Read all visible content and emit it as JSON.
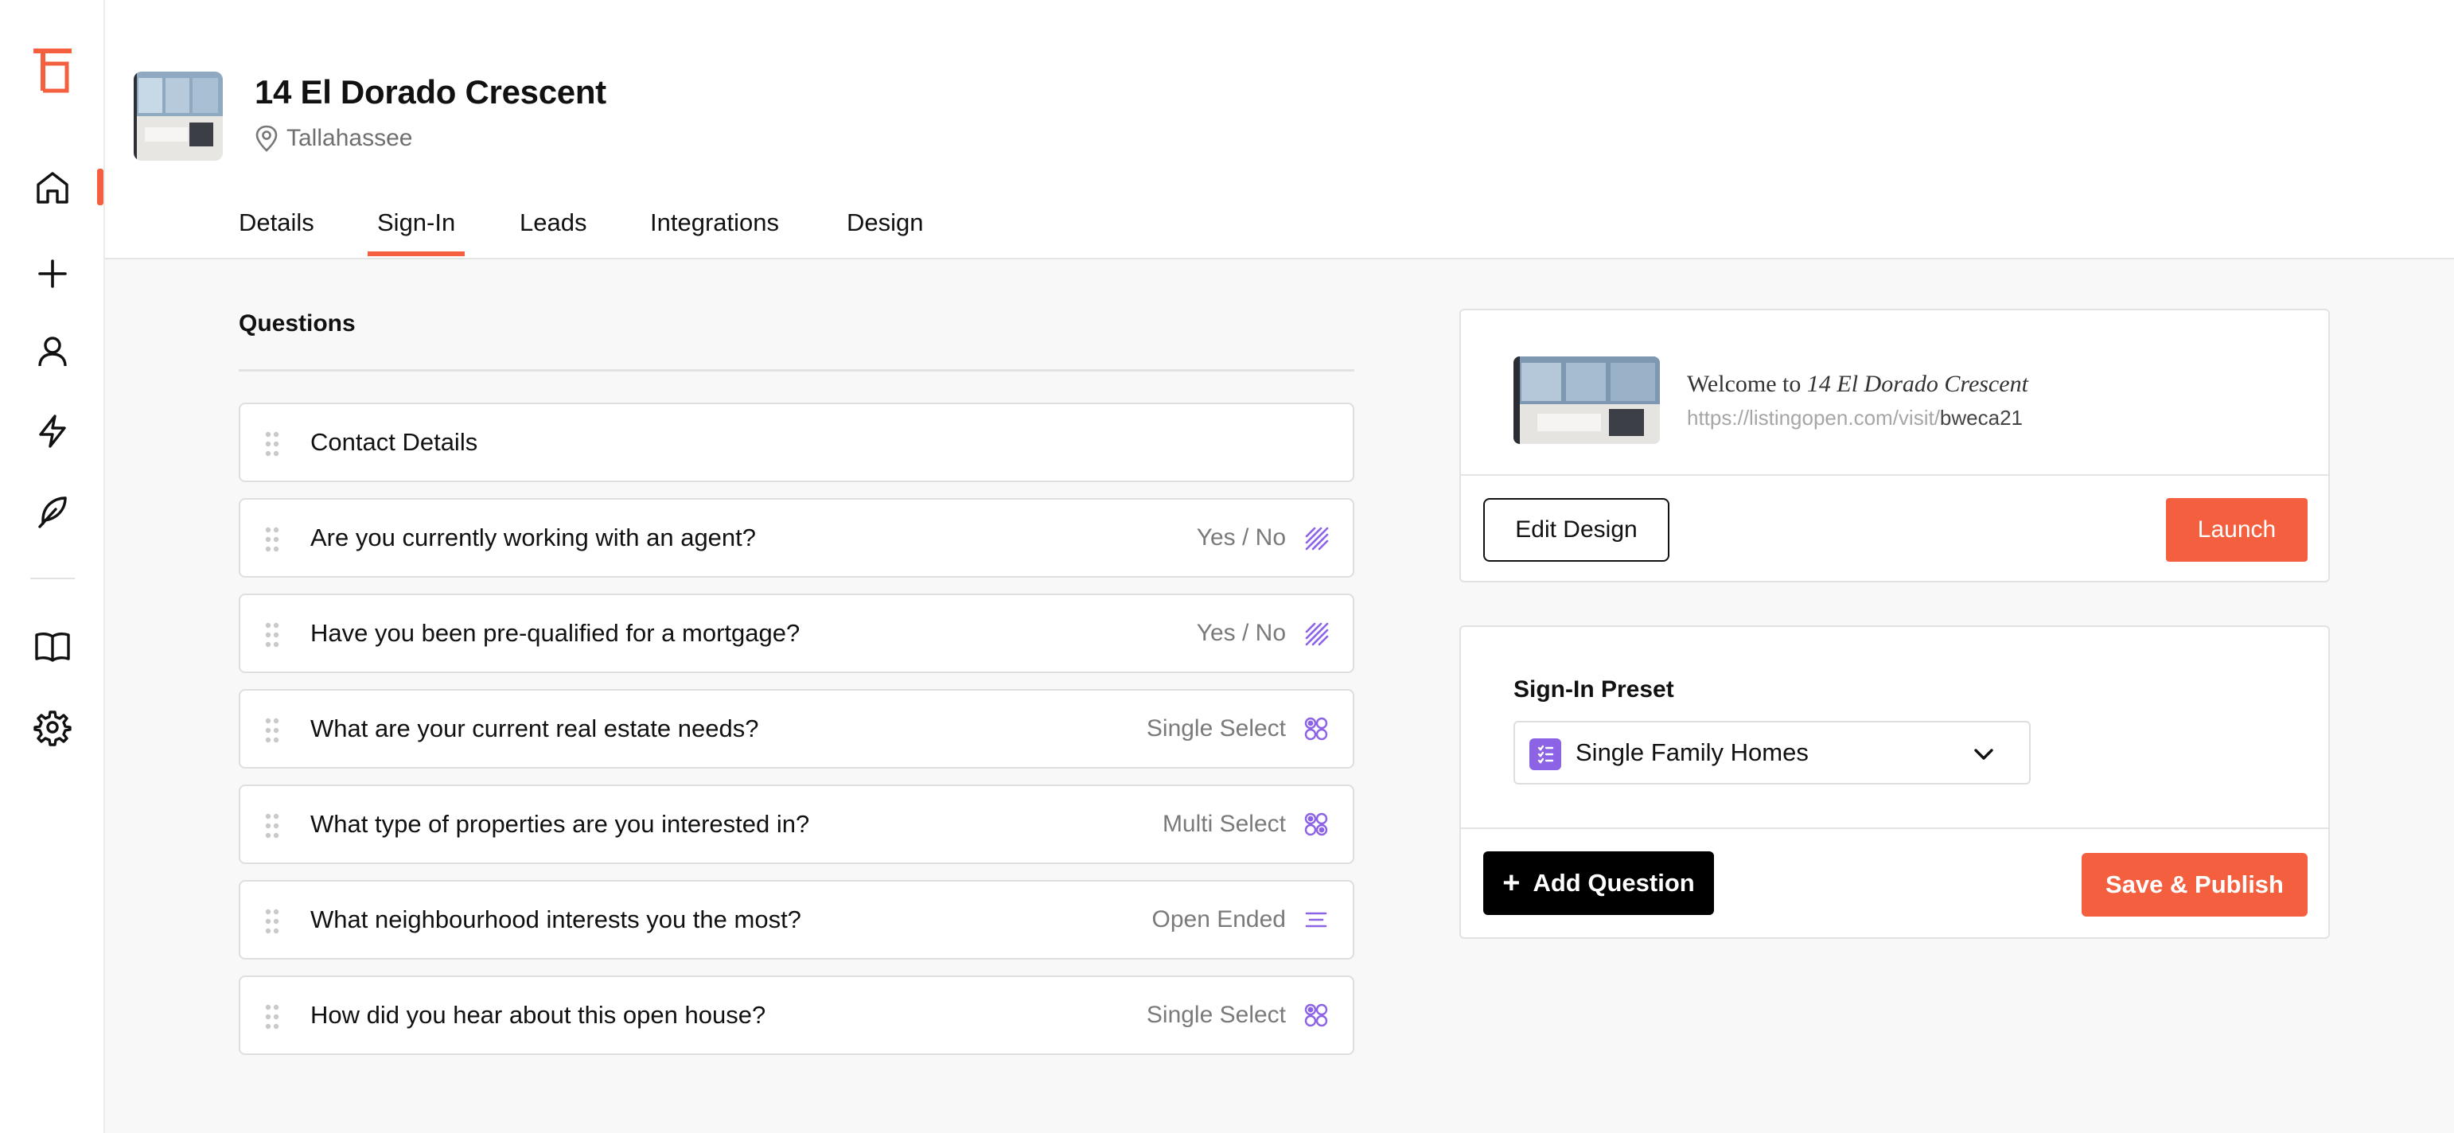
{
  "sidebar": {
    "logo_icon": "listingopen-logo-icon",
    "items": [
      {
        "name": "home",
        "icon": "home-icon",
        "active": true
      },
      {
        "name": "add",
        "icon": "plus-icon"
      },
      {
        "name": "contacts",
        "icon": "user-icon"
      },
      {
        "name": "automations",
        "icon": "lightning-icon"
      },
      {
        "name": "design",
        "icon": "feather-icon"
      },
      {
        "name": "guides",
        "icon": "book-icon"
      },
      {
        "name": "settings",
        "icon": "gear-icon"
      }
    ],
    "accent_color": "#f4603f"
  },
  "header": {
    "title": "14 El Dorado Crescent",
    "location": "Tallahassee",
    "tabs": [
      {
        "label": "Details"
      },
      {
        "label": "Sign-In",
        "active": true
      },
      {
        "label": "Leads"
      },
      {
        "label": "Integrations"
      },
      {
        "label": "Design"
      }
    ]
  },
  "questions": {
    "heading": "Questions",
    "items": [
      {
        "text": "Contact Details",
        "type": "",
        "icon": ""
      },
      {
        "text": "Are you currently working with an agent?",
        "type": "Yes / No",
        "icon": "yes-no-icon"
      },
      {
        "text": "Have you been pre-qualified for a mortgage?",
        "type": "Yes / No",
        "icon": "yes-no-icon"
      },
      {
        "text": "What are your current real estate needs?",
        "type": "Single Select",
        "icon": "single-select-icon"
      },
      {
        "text": "What type of properties are you interested in?",
        "type": "Multi Select",
        "icon": "multi-select-icon"
      },
      {
        "text": "What neighbourhood interests you the most?",
        "type": "Open Ended",
        "icon": "open-ended-icon"
      },
      {
        "text": "How did you hear about this open house?",
        "type": "Single Select",
        "icon": "single-select-icon"
      }
    ],
    "type_icon_color": "#8d63e5"
  },
  "preview": {
    "welcome_prefix": "Welcome to",
    "welcome_name": "14 El Dorado Crescent",
    "url_base": "https://listingopen.com/visit/",
    "url_slug": "bweca21",
    "edit_label": "Edit Design",
    "launch_label": "Launch"
  },
  "preset": {
    "label": "Sign-In Preset",
    "selected": "Single Family Homes",
    "add_label": "Add Question",
    "publish_label": "Save & Publish"
  }
}
